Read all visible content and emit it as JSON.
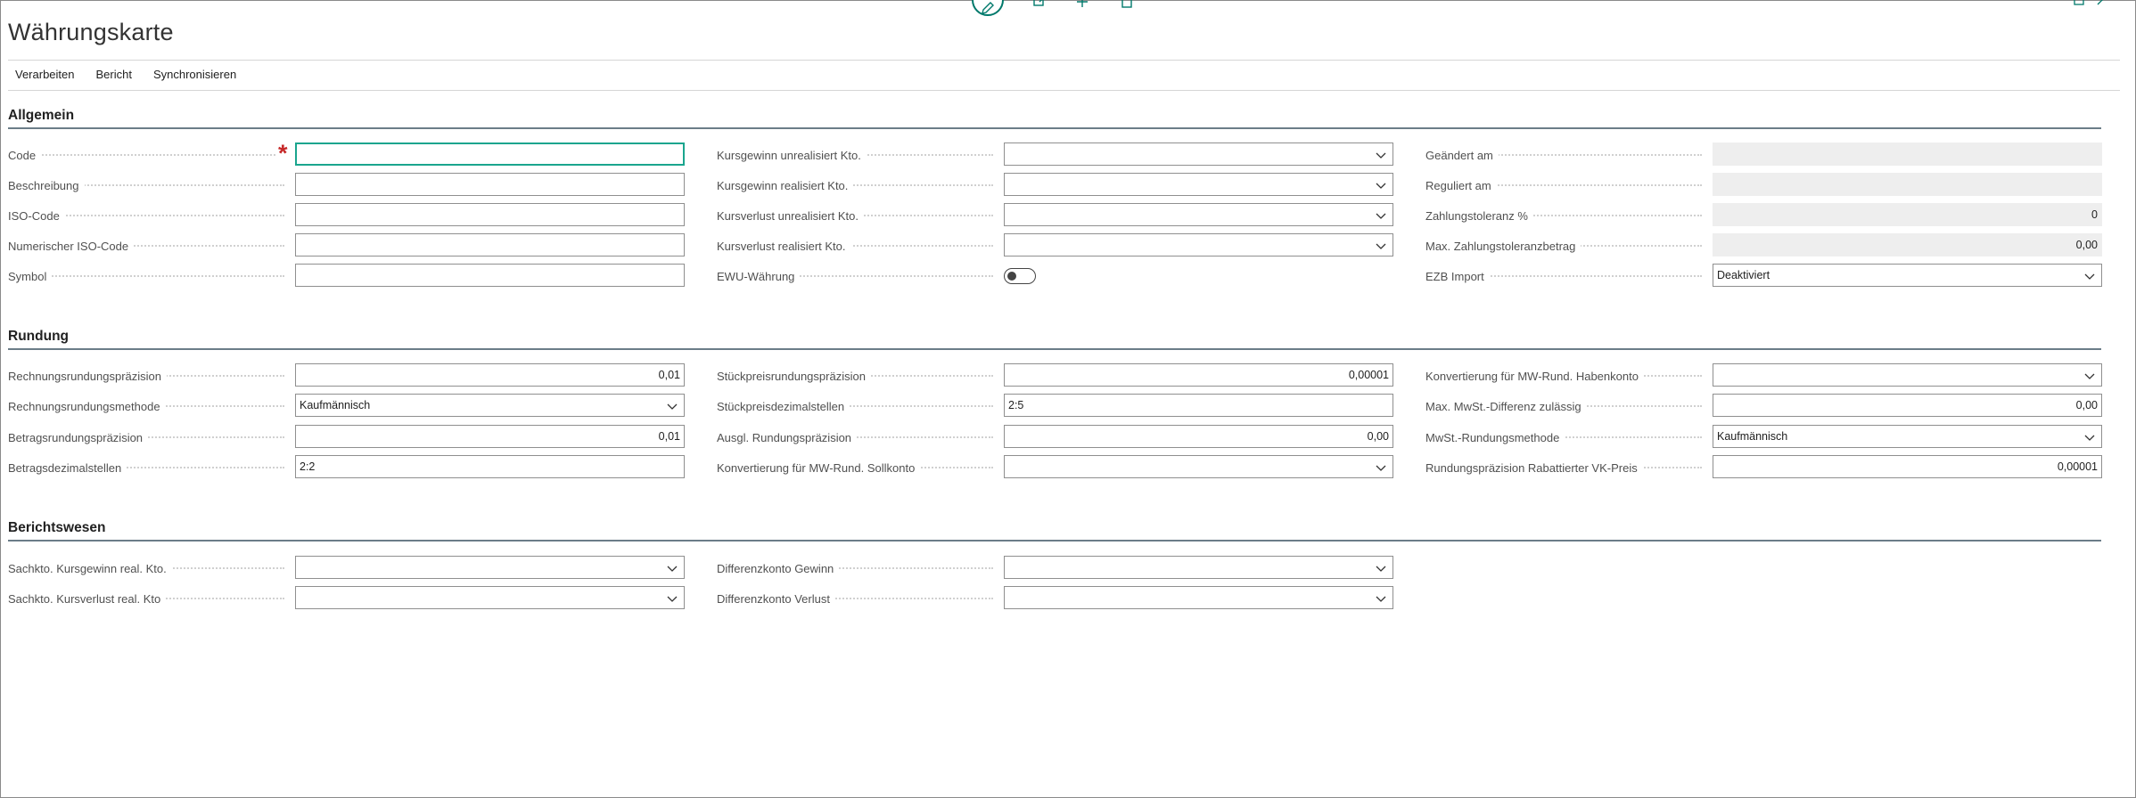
{
  "page": {
    "title": "Währungskarte"
  },
  "actions": [
    "Verarbeiten",
    "Bericht",
    "Synchronisieren"
  ],
  "sections": {
    "allgemein": "Allgemein",
    "rundung": "Rundung",
    "berichtswesen": "Berichtswesen"
  },
  "allgemein": {
    "col1": [
      {
        "label": "Code",
        "value": "",
        "required": true
      },
      {
        "label": "Beschreibung",
        "value": ""
      },
      {
        "label": "ISO-Code",
        "value": ""
      },
      {
        "label": "Numerischer ISO-Code",
        "value": ""
      },
      {
        "label": "Symbol",
        "value": ""
      }
    ],
    "col2": [
      {
        "label": "Kursgewinn unrealisiert Kto.",
        "value": ""
      },
      {
        "label": "Kursgewinn realisiert Kto.",
        "value": ""
      },
      {
        "label": "Kursverlust unrealisiert Kto.",
        "value": ""
      },
      {
        "label": "Kursverlust realisiert Kto.",
        "value": ""
      },
      {
        "label": "EWU-Währung",
        "value": ""
      }
    ],
    "col3": [
      {
        "label": "Geändert am",
        "value": ""
      },
      {
        "label": "Reguliert am",
        "value": ""
      },
      {
        "label": "Zahlungstoleranz %",
        "value": "0"
      },
      {
        "label": "Max. Zahlungstoleranzbetrag",
        "value": "0,00"
      },
      {
        "label": "EZB Import",
        "value": "Deaktiviert"
      }
    ]
  },
  "rundung": {
    "col1": [
      {
        "label": "Rechnungsrundungspräzision",
        "value": "0,01"
      },
      {
        "label": "Rechnungsrundungsmethode",
        "value": "Kaufmännisch"
      },
      {
        "label": "Betragsrundungspräzision",
        "value": "0,01"
      },
      {
        "label": "Betragsdezimalstellen",
        "value": "2:2"
      }
    ],
    "col2": [
      {
        "label": "Stückpreisrundungspräzision",
        "value": "0,00001"
      },
      {
        "label": "Stückpreisdezimalstellen",
        "value": "2:5"
      },
      {
        "label": "Ausgl. Rundungspräzision",
        "value": "0,00"
      },
      {
        "label": "Konvertierung für MW-Rund. Sollkonto",
        "value": ""
      }
    ],
    "col3": [
      {
        "label": "Konvertierung für MW-Rund. Habenkonto",
        "value": ""
      },
      {
        "label": "Max. MwSt.-Differenz zulässig",
        "value": "0,00"
      },
      {
        "label": "MwSt.-Rundungsmethode",
        "value": "Kaufmännisch"
      },
      {
        "label": "Rundungspräzision Rabattierter VK-Preis",
        "value": "0,00001"
      }
    ]
  },
  "berichtswesen": {
    "col1": [
      {
        "label": "Sachkto. Kursgewinn real. Kto.",
        "value": ""
      },
      {
        "label": "Sachkto. Kursverlust real. Kto",
        "value": ""
      }
    ],
    "col2": [
      {
        "label": "Differenzkonto Gewinn",
        "value": ""
      },
      {
        "label": "Differenzkonto Verlust",
        "value": ""
      }
    ]
  },
  "icons": [
    "edit-icon",
    "share-icon",
    "add-icon",
    "delete-icon",
    "expand-icon",
    "collapse-icon",
    "chevron-down-icon"
  ],
  "colors": {
    "accent": "#00796b",
    "required": "#c62828",
    "section_rule": "#6b7d88"
  }
}
